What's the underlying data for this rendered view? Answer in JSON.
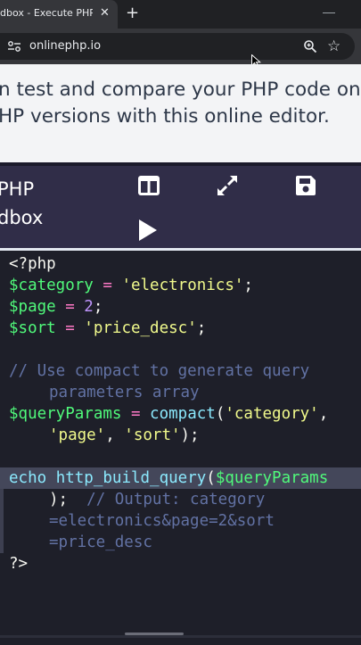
{
  "browser": {
    "tab_title": "dbox - Execute PHP code",
    "tab_close": "✕",
    "new_tab": "+",
    "url": "onlinephp.io"
  },
  "intro": {
    "line1": "n test and compare your PHP code on",
    "line2": "HP versions with this online editor."
  },
  "toolbar": {
    "brand_line1": "PHP",
    "brand_line2": "dbox"
  },
  "code": {
    "lines": [
      [
        {
          "t": "<?php",
          "c": "plain"
        }
      ],
      [
        {
          "t": "$category",
          "c": "var"
        },
        {
          "t": " = ",
          "c": "op"
        },
        {
          "t": "'electronics'",
          "c": "str"
        },
        {
          "t": ";",
          "c": "plain"
        }
      ],
      [
        {
          "t": "$page",
          "c": "var"
        },
        {
          "t": " = ",
          "c": "op"
        },
        {
          "t": "2",
          "c": "num"
        },
        {
          "t": ";",
          "c": "plain"
        }
      ],
      [
        {
          "t": "$sort",
          "c": "var"
        },
        {
          "t": " = ",
          "c": "op"
        },
        {
          "t": "'price_desc'",
          "c": "str"
        },
        {
          "t": ";",
          "c": "plain"
        }
      ],
      [],
      [
        {
          "t": "// Use compact to generate query",
          "c": "cmt"
        }
      ],
      [
        {
          "t": "parameters array",
          "c": "cmt",
          "indent": true
        }
      ],
      [
        {
          "t": "$queryParams",
          "c": "var"
        },
        {
          "t": " = ",
          "c": "op"
        },
        {
          "t": "compact",
          "c": "fn"
        },
        {
          "t": "(",
          "c": "plain"
        },
        {
          "t": "'category'",
          "c": "str"
        },
        {
          "t": ",",
          "c": "plain"
        }
      ],
      [
        {
          "t": "'page'",
          "c": "str",
          "indent": true
        },
        {
          "t": ", ",
          "c": "plain"
        },
        {
          "t": "'sort'",
          "c": "str"
        },
        {
          "t": ");",
          "c": "plain"
        }
      ],
      [],
      [
        {
          "t": "echo",
          "c": "fn"
        },
        {
          "t": " ",
          "c": "plain"
        },
        {
          "t": "http_build_query",
          "c": "fn"
        },
        {
          "t": "(",
          "c": "plain"
        },
        {
          "t": "$queryParams",
          "c": "var"
        }
      ],
      [
        {
          "t": ");  ",
          "c": "plain",
          "indent": true
        },
        {
          "t": "// Output: category",
          "c": "cmt"
        }
      ],
      [
        {
          "t": "=electronics&page=2&sort",
          "c": "cmt",
          "indent": true
        }
      ],
      [
        {
          "t": "=price_desc",
          "c": "cmt",
          "indent": true
        }
      ],
      [
        {
          "t": "?>",
          "c": "plain"
        }
      ]
    ]
  },
  "colors": {
    "toolbar_bg": "#302d48",
    "editor_bg": "#1e1f29",
    "variable": "#50fa7b",
    "string": "#f1fa8c",
    "operator": "#ff79c6",
    "number": "#bd93f9",
    "function": "#8be9fd",
    "comment": "#6272a4"
  },
  "icons": {
    "toolbar": [
      "layout-split-icon",
      "fullscreen-icon",
      "save-icon",
      "play-icon"
    ],
    "browser": [
      "site-settings-icon",
      "zoom-icon",
      "bookmark-star-icon"
    ]
  }
}
